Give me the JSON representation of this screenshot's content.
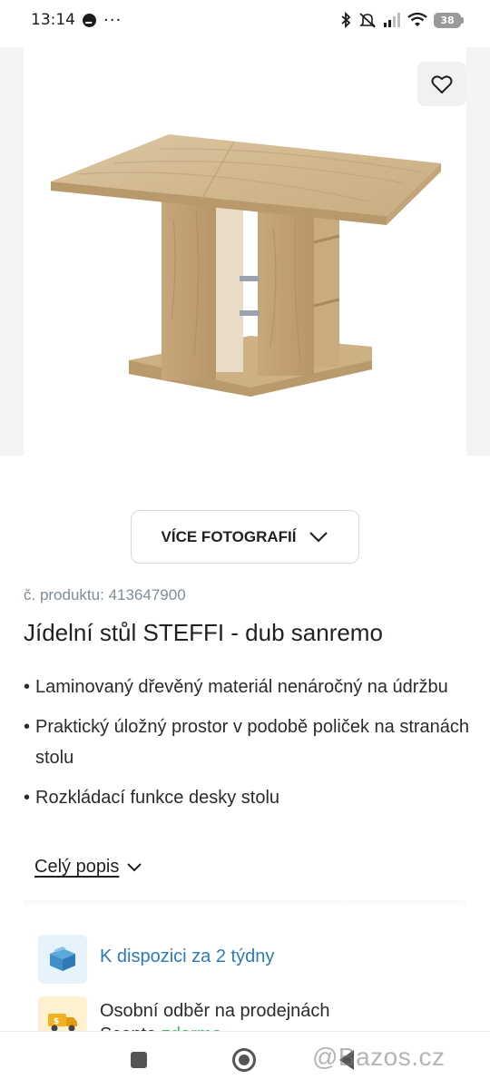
{
  "status_bar": {
    "time": "13:14",
    "battery": "38",
    "icons": [
      "messenger-icon",
      "more-dots-icon",
      "bluetooth-icon",
      "mute-icon",
      "signal-icon",
      "wifi-icon",
      "battery-icon"
    ],
    "dots": "···"
  },
  "gallery": {
    "favorite_icon": "heart-outline-icon",
    "more_photos_label": "VÍCE FOTOGRAFIÍ",
    "more_photos_icon": "chevron-down-icon"
  },
  "product": {
    "number_label": "č. produktu:",
    "number_value": "413647900",
    "title": "Jídelní stůl STEFFI - dub sanremo",
    "features": [
      "Laminovaný dřevěný materiál nenáročný na údržbu",
      "Praktický úložný prostor v podobě poliček na stranách stolu",
      "Rozkládací funkce desky stolu"
    ],
    "full_description_label": "Celý popis"
  },
  "delivery": {
    "availability_text": "K dispozici za 2 týdny",
    "availability_icon": "box-icon",
    "pickup_line1": "Osobní odběr na prodejnách",
    "pickup_line2_prefix": "Sconto ",
    "pickup_free": "zdarma",
    "pickup_icon": "delivery-truck-icon"
  },
  "nav_bar": {
    "watermark": "@Bazos.cz",
    "icons": [
      "recents-square-icon",
      "home-circle-icon",
      "back-triangle-icon"
    ]
  },
  "colors": {
    "link_blue": "#2d7ab8",
    "free_green": "#3bb46a",
    "muted_gray": "#7f8d97",
    "wood": "#d8c09a"
  }
}
